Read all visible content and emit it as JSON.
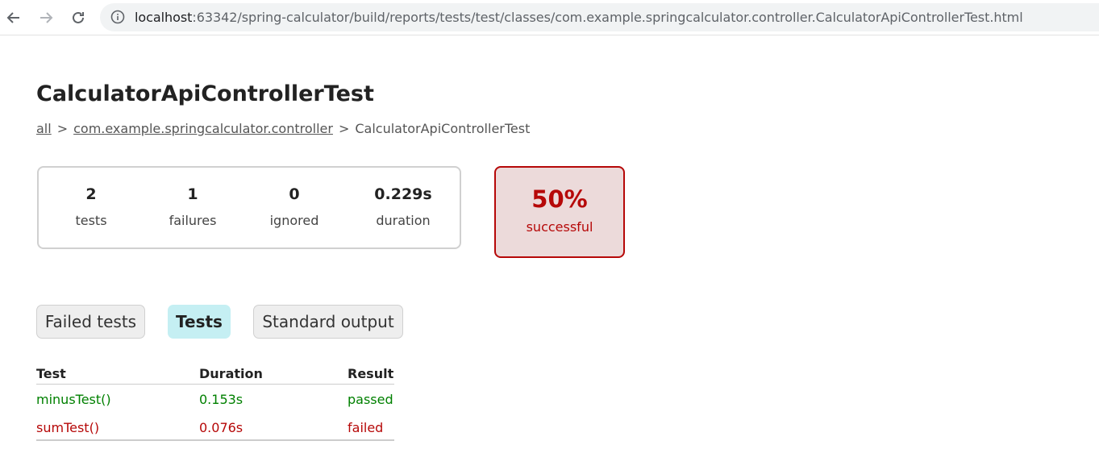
{
  "browser": {
    "url_host": "localhost",
    "url_rest": ":63342/spring-calculator/build/reports/tests/test/classes/com.example.springcalculator.controller.CalculatorApiControllerTest.html"
  },
  "page": {
    "title": "CalculatorApiControllerTest",
    "breadcrumb": {
      "all": "all",
      "package": "com.example.springcalculator.controller",
      "current": "CalculatorApiControllerTest",
      "separator": ">"
    }
  },
  "summary": {
    "tests": {
      "value": "2",
      "label": "tests"
    },
    "failures": {
      "value": "1",
      "label": "failures"
    },
    "ignored": {
      "value": "0",
      "label": "ignored"
    },
    "duration": {
      "value": "0.229s",
      "label": "duration"
    }
  },
  "success": {
    "percent": "50%",
    "label": "successful",
    "color": "#b60808"
  },
  "tabs": {
    "failed": "Failed tests",
    "tests": "Tests",
    "stdout": "Standard output",
    "active": "Tests"
  },
  "table": {
    "headers": {
      "test": "Test",
      "duration": "Duration",
      "result": "Result"
    },
    "rows": [
      {
        "test": "minusTest()",
        "duration": "0.153s",
        "result": "passed",
        "color": "#008000"
      },
      {
        "test": "sumTest()",
        "duration": "0.076s",
        "result": "failed",
        "color": "#b60808"
      }
    ]
  }
}
